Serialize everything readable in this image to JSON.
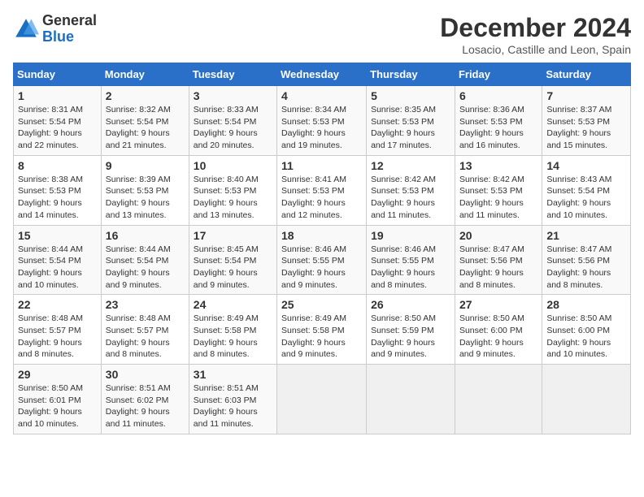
{
  "logo": {
    "general": "General",
    "blue": "Blue"
  },
  "header": {
    "title": "December 2024",
    "subtitle": "Losacio, Castille and Leon, Spain"
  },
  "weekdays": [
    "Sunday",
    "Monday",
    "Tuesday",
    "Wednesday",
    "Thursday",
    "Friday",
    "Saturday"
  ],
  "weeks": [
    [
      {
        "day": "1",
        "sunrise": "8:31 AM",
        "sunset": "5:54 PM",
        "daylight": "9 hours and 22 minutes."
      },
      {
        "day": "2",
        "sunrise": "8:32 AM",
        "sunset": "5:54 PM",
        "daylight": "9 hours and 21 minutes."
      },
      {
        "day": "3",
        "sunrise": "8:33 AM",
        "sunset": "5:54 PM",
        "daylight": "9 hours and 20 minutes."
      },
      {
        "day": "4",
        "sunrise": "8:34 AM",
        "sunset": "5:53 PM",
        "daylight": "9 hours and 19 minutes."
      },
      {
        "day": "5",
        "sunrise": "8:35 AM",
        "sunset": "5:53 PM",
        "daylight": "9 hours and 17 minutes."
      },
      {
        "day": "6",
        "sunrise": "8:36 AM",
        "sunset": "5:53 PM",
        "daylight": "9 hours and 16 minutes."
      },
      {
        "day": "7",
        "sunrise": "8:37 AM",
        "sunset": "5:53 PM",
        "daylight": "9 hours and 15 minutes."
      }
    ],
    [
      {
        "day": "8",
        "sunrise": "8:38 AM",
        "sunset": "5:53 PM",
        "daylight": "9 hours and 14 minutes."
      },
      {
        "day": "9",
        "sunrise": "8:39 AM",
        "sunset": "5:53 PM",
        "daylight": "9 hours and 13 minutes."
      },
      {
        "day": "10",
        "sunrise": "8:40 AM",
        "sunset": "5:53 PM",
        "daylight": "9 hours and 13 minutes."
      },
      {
        "day": "11",
        "sunrise": "8:41 AM",
        "sunset": "5:53 PM",
        "daylight": "9 hours and 12 minutes."
      },
      {
        "day": "12",
        "sunrise": "8:42 AM",
        "sunset": "5:53 PM",
        "daylight": "9 hours and 11 minutes."
      },
      {
        "day": "13",
        "sunrise": "8:42 AM",
        "sunset": "5:53 PM",
        "daylight": "9 hours and 11 minutes."
      },
      {
        "day": "14",
        "sunrise": "8:43 AM",
        "sunset": "5:54 PM",
        "daylight": "9 hours and 10 minutes."
      }
    ],
    [
      {
        "day": "15",
        "sunrise": "8:44 AM",
        "sunset": "5:54 PM",
        "daylight": "9 hours and 10 minutes."
      },
      {
        "day": "16",
        "sunrise": "8:44 AM",
        "sunset": "5:54 PM",
        "daylight": "9 hours and 9 minutes."
      },
      {
        "day": "17",
        "sunrise": "8:45 AM",
        "sunset": "5:54 PM",
        "daylight": "9 hours and 9 minutes."
      },
      {
        "day": "18",
        "sunrise": "8:46 AM",
        "sunset": "5:55 PM",
        "daylight": "9 hours and 9 minutes."
      },
      {
        "day": "19",
        "sunrise": "8:46 AM",
        "sunset": "5:55 PM",
        "daylight": "9 hours and 8 minutes."
      },
      {
        "day": "20",
        "sunrise": "8:47 AM",
        "sunset": "5:56 PM",
        "daylight": "9 hours and 8 minutes."
      },
      {
        "day": "21",
        "sunrise": "8:47 AM",
        "sunset": "5:56 PM",
        "daylight": "9 hours and 8 minutes."
      }
    ],
    [
      {
        "day": "22",
        "sunrise": "8:48 AM",
        "sunset": "5:57 PM",
        "daylight": "9 hours and 8 minutes."
      },
      {
        "day": "23",
        "sunrise": "8:48 AM",
        "sunset": "5:57 PM",
        "daylight": "9 hours and 8 minutes."
      },
      {
        "day": "24",
        "sunrise": "8:49 AM",
        "sunset": "5:58 PM",
        "daylight": "9 hours and 8 minutes."
      },
      {
        "day": "25",
        "sunrise": "8:49 AM",
        "sunset": "5:58 PM",
        "daylight": "9 hours and 9 minutes."
      },
      {
        "day": "26",
        "sunrise": "8:50 AM",
        "sunset": "5:59 PM",
        "daylight": "9 hours and 9 minutes."
      },
      {
        "day": "27",
        "sunrise": "8:50 AM",
        "sunset": "6:00 PM",
        "daylight": "9 hours and 9 minutes."
      },
      {
        "day": "28",
        "sunrise": "8:50 AM",
        "sunset": "6:00 PM",
        "daylight": "9 hours and 10 minutes."
      }
    ],
    [
      {
        "day": "29",
        "sunrise": "8:50 AM",
        "sunset": "6:01 PM",
        "daylight": "9 hours and 10 minutes."
      },
      {
        "day": "30",
        "sunrise": "8:51 AM",
        "sunset": "6:02 PM",
        "daylight": "9 hours and 11 minutes."
      },
      {
        "day": "31",
        "sunrise": "8:51 AM",
        "sunset": "6:03 PM",
        "daylight": "9 hours and 11 minutes."
      },
      null,
      null,
      null,
      null
    ]
  ]
}
